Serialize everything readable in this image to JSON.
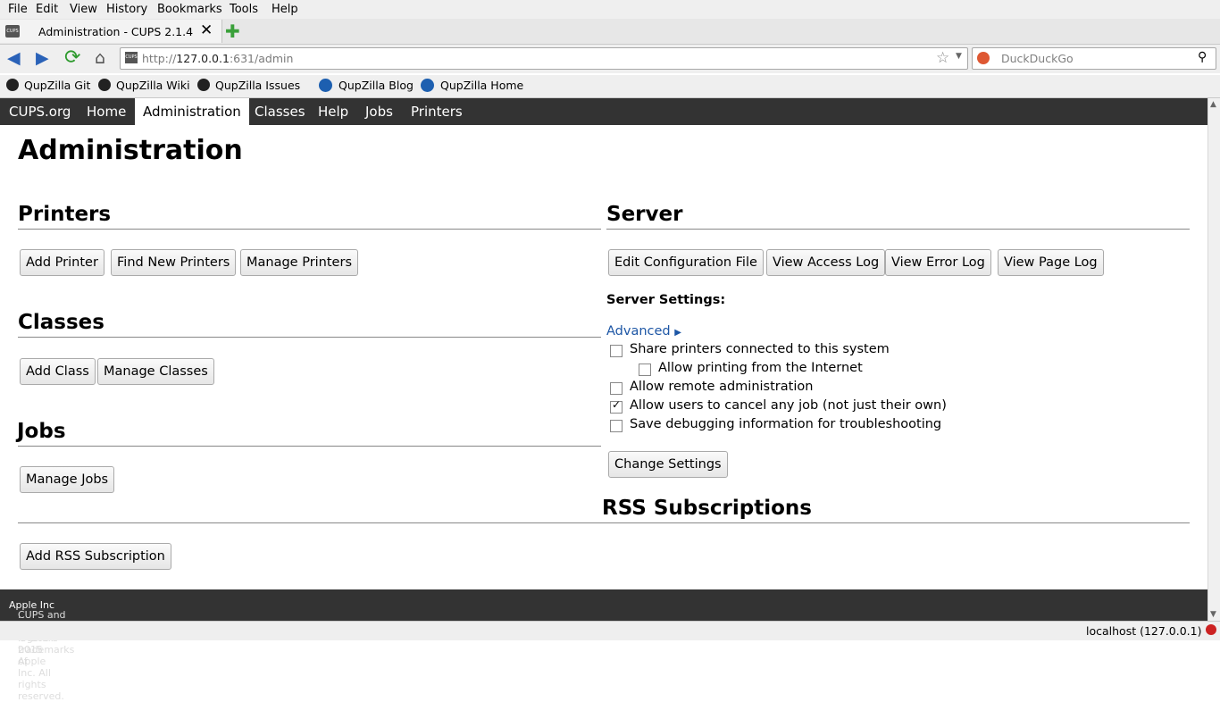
{
  "menubar": [
    "File",
    "Edit",
    "View",
    "History",
    "Bookmarks",
    "Tools",
    "Help"
  ],
  "tab": {
    "title": "Administration - CUPS 2.1.4",
    "favicon_text": "CUPS"
  },
  "url": {
    "prefix": "http://",
    "host": "127.0.0.1",
    "rest": ":631/admin"
  },
  "search_placeholder": "DuckDuckGo",
  "bookmarks": [
    "QupZilla Git",
    "QupZilla Wiki",
    "QupZilla Issues",
    "QupZilla Blog",
    "QupZilla Home"
  ],
  "cups_nav": [
    "CUPS.org",
    "Home",
    "Administration",
    "Classes",
    "Help",
    "Jobs",
    "Printers"
  ],
  "page_title": "Administration",
  "printers": {
    "heading": "Printers",
    "buttons": [
      "Add Printer",
      "Find New Printers",
      "Manage Printers"
    ]
  },
  "classes": {
    "heading": "Classes",
    "buttons": [
      "Add Class",
      "Manage Classes"
    ]
  },
  "jobs": {
    "heading": "Jobs",
    "buttons": [
      "Manage Jobs"
    ]
  },
  "server": {
    "heading": "Server",
    "buttons": [
      "Edit Configuration File",
      "View Access Log",
      "View Error Log",
      "View Page Log"
    ],
    "settings_label": "Server Settings:",
    "advanced": "Advanced",
    "options": [
      {
        "label": "Share printers connected to this system",
        "checked": false
      },
      {
        "label": "Allow printing from the Internet",
        "checked": false
      },
      {
        "label": "Allow remote administration",
        "checked": false
      },
      {
        "label": "Allow users to cancel any job (not just their own)",
        "checked": true
      },
      {
        "label": "Save debugging information for troubleshooting",
        "checked": false
      }
    ],
    "change_button": "Change Settings"
  },
  "rss": {
    "heading": "RSS Subscriptions",
    "button": "Add RSS Subscription"
  },
  "footer": {
    "text_pre": "CUPS and the CUPS logo are trademarks of ",
    "apple": "Apple Inc",
    "text_post": ". Copyright © 2007-2015 Apple Inc. All rights reserved."
  },
  "status_host": "localhost (127.0.0.1)"
}
